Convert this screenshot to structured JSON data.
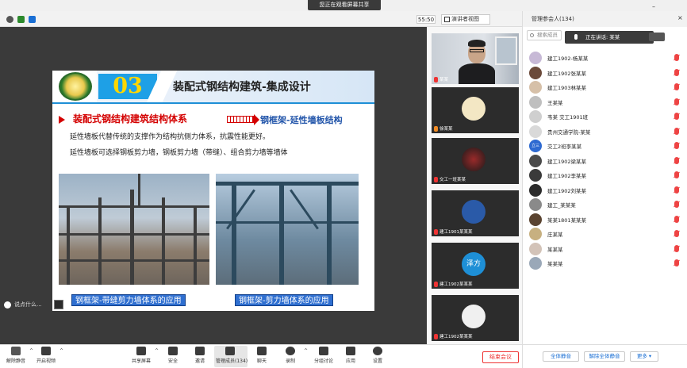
{
  "top_bar": {
    "toast_text": "您正在观看屏幕共享"
  },
  "control_row": {
    "timer": "55:50",
    "view_option": "演讲者视图"
  },
  "slide": {
    "number": "03",
    "title": "装配式钢结构建筑-集成设计",
    "subheading_left": "装配式钢结构建筑结构体系",
    "subheading_right": "钢框架-延性墙板结构",
    "line1": "延性墙板代替传统的支撑作为结构抗侧力体系，抗震性能更好。",
    "line2": "延性墙板可选择钢板剪力墙，钢板剪力墙（带缝）、组合剪力墙等墙体",
    "caption1": "钢框架-带缝剪力墙体系的应用",
    "caption2": "钢框架-剪力墙体系的应用"
  },
  "share_chat": {
    "placeholder": "说点什么..."
  },
  "video_tiles": [
    {
      "label": "某某",
      "muted": true
    },
    {
      "label": "徐某某",
      "muted": true
    },
    {
      "label": "交工一班某某",
      "muted": true
    },
    {
      "label": "建工1901某某某",
      "muted": true
    },
    {
      "label": "建工1902某某某",
      "muted": true,
      "avatar_text": "泽方"
    },
    {
      "label": "建工1902某某某",
      "muted": true
    }
  ],
  "panel": {
    "title": "管理参会人(134)",
    "search_placeholder": "搜索成员",
    "speaker_label": "正在讲话: 某某",
    "participants": [
      {
        "name": "建工1902-杨某某",
        "color": "#c7b9d6"
      },
      {
        "name": "建工1902张某某",
        "color": "#6b4a3a"
      },
      {
        "name": "建工1903林某某",
        "color": "#d6c0a8"
      },
      {
        "name": "王某某",
        "color": "#bfbfbf"
      },
      {
        "name": "韦某 交工1901班",
        "color": "#cfcfcf"
      },
      {
        "name": "贵州交通学院-某某",
        "color": "#d9d9d9"
      },
      {
        "name": "交工2班李某某",
        "color": "#2e6ad1",
        "avatar_text": "立三"
      },
      {
        "name": "建工1902梁某某",
        "color": "#4a4a4a"
      },
      {
        "name": "建工1902李某某",
        "color": "#3a3a3a"
      },
      {
        "name": "建工1902刘某某",
        "color": "#2c2c2c"
      },
      {
        "name": "建工_某某某",
        "color": "#8a8a8a"
      },
      {
        "name": "某某1801某某某",
        "color": "#5a4330"
      },
      {
        "name": "庄某某",
        "color": "#c7b080"
      },
      {
        "name": "某某某",
        "color": "#d3c3b8"
      },
      {
        "name": "某某某",
        "color": "#9aa8b8"
      }
    ],
    "mute_all": "全体静音",
    "unmute_all": "解除全体静音",
    "more": "更多"
  },
  "toolbar": {
    "unmute": "解除静音",
    "start_video": "开启视频",
    "share_screen": "共享屏幕",
    "security": "安全",
    "invite": "邀请",
    "manage_participants": "管理成员(134)",
    "chat": "聊天",
    "record": "录制",
    "breakout": "分组讨论",
    "apps": "应用",
    "settings": "设置",
    "end_meeting": "结束会议"
  },
  "colors": {
    "accent_blue": "#1ea0e6",
    "caption_blue": "#2f6fd0",
    "alert_red": "#d40000",
    "mute_red": "#e44444"
  }
}
